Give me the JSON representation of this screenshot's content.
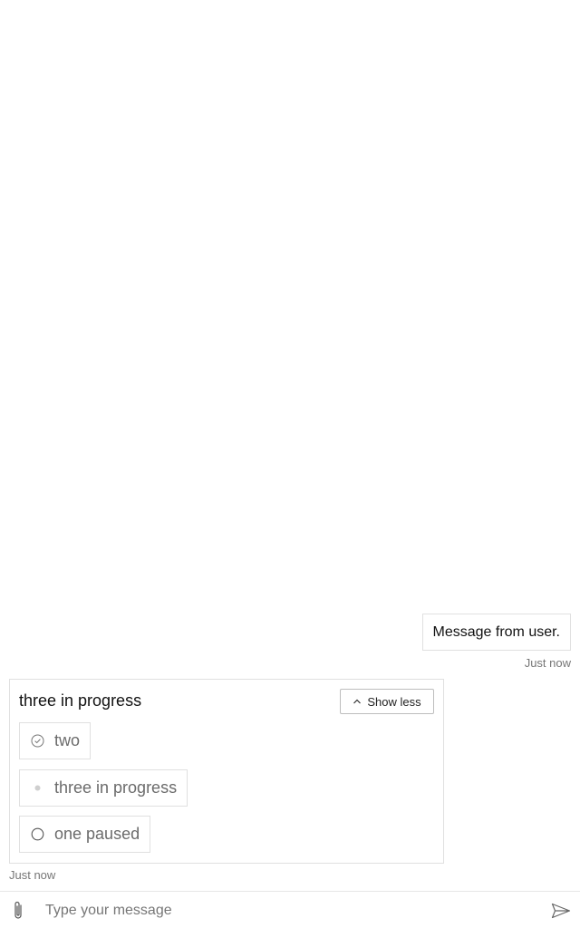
{
  "transcript": {
    "user_message": {
      "text": "Message from user.",
      "timestamp": "Just now"
    },
    "bot_card": {
      "title": "three in progress",
      "toggle_label": "Show less",
      "toggle_icon": "chevron-up-icon",
      "tasks": [
        {
          "label": "two",
          "status": "completed",
          "icon": "check-circle-icon"
        },
        {
          "label": "three in progress",
          "status": "in-progress",
          "icon": "dot-icon"
        },
        {
          "label": "one paused",
          "status": "paused",
          "icon": "empty-circle-icon"
        }
      ],
      "timestamp": "Just now"
    }
  },
  "sendbox": {
    "placeholder": "Type your message",
    "attach_icon": "paperclip-icon",
    "send_icon": "send-icon"
  },
  "colors": {
    "border": "#e0e0e0",
    "muted_text": "#767676",
    "task_text": "#6b6b6b"
  }
}
